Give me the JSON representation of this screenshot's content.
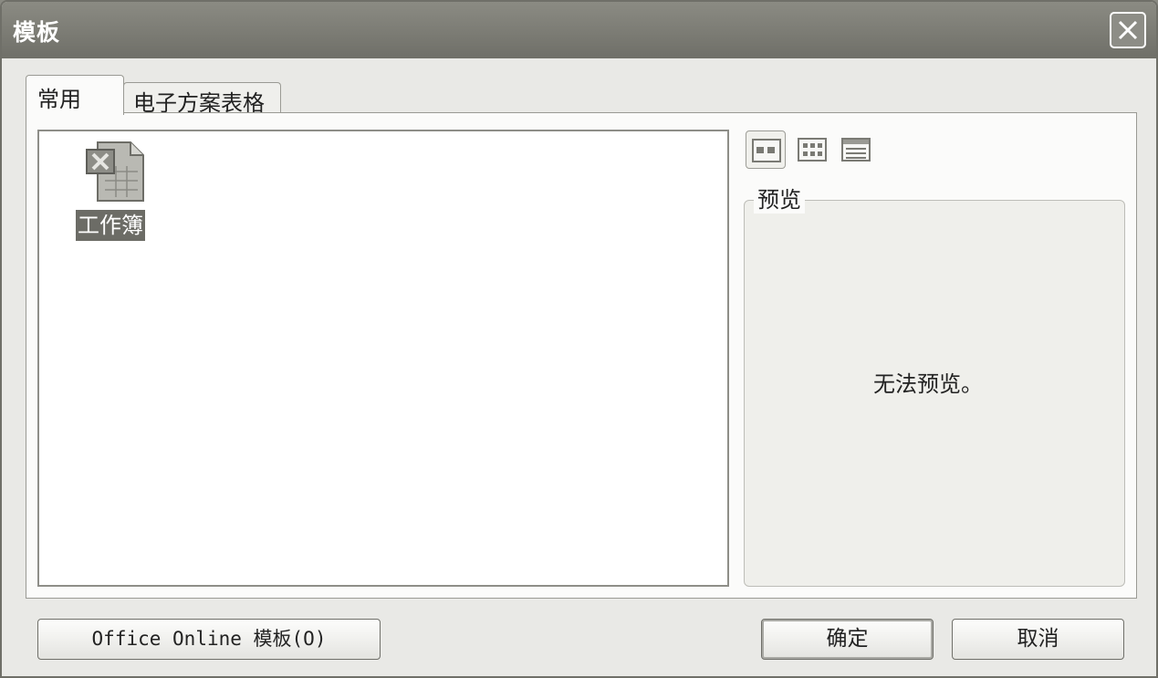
{
  "window": {
    "title": "模板",
    "close_icon": "close-icon"
  },
  "tabs": [
    {
      "label": "常用",
      "selected": true
    },
    {
      "label": "电子方案表格",
      "selected": false
    }
  ],
  "template_list": {
    "items": [
      {
        "label": "工作簿",
        "icon": "excel-workbook-icon",
        "selected": true
      }
    ]
  },
  "view_buttons": [
    {
      "icon": "large-icons-view-icon",
      "active": true
    },
    {
      "icon": "list-view-icon",
      "active": false
    },
    {
      "icon": "details-view-icon",
      "active": false
    }
  ],
  "preview": {
    "legend": "预览",
    "empty_text": "无法预览。"
  },
  "buttons": {
    "online_label": "Office Online 模板(O)",
    "ok_label": "确定",
    "cancel_label": "取消"
  },
  "colors": {
    "titlebar": "#7d7d76",
    "dialog_bg": "#e9e9e6",
    "selection": "#6c6c66"
  }
}
